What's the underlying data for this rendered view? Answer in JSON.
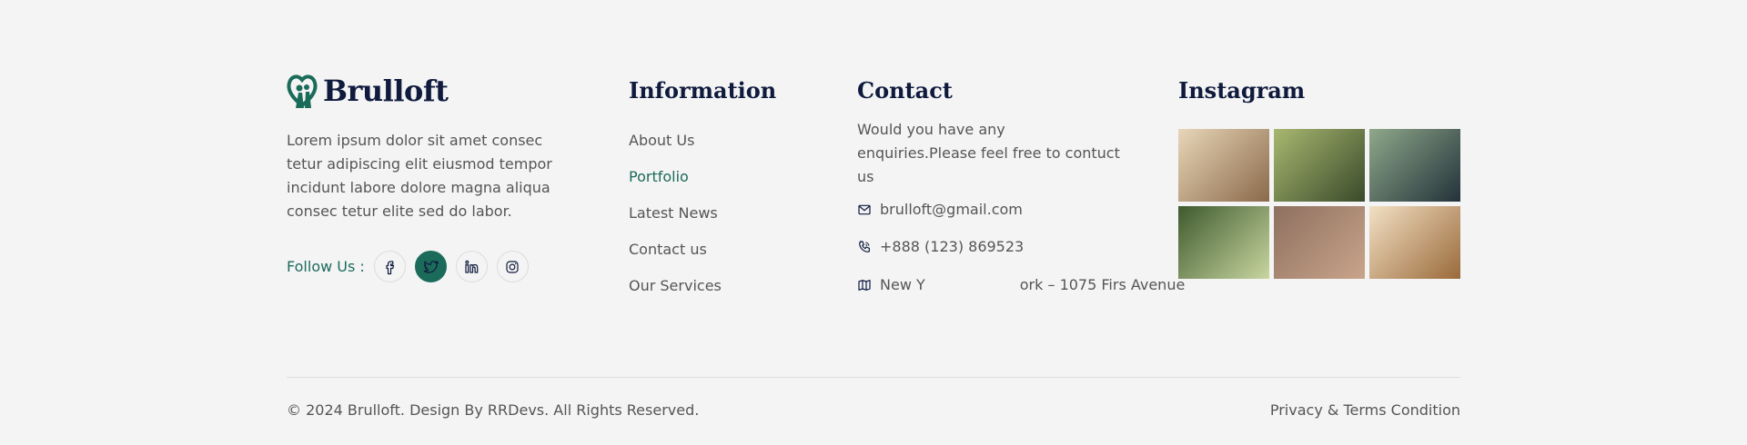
{
  "brand": {
    "name": "Brulloft",
    "logo_icon": "heart-couple-logo",
    "accent": "#1b6b5a"
  },
  "about": {
    "text": "Lorem ipsum dolor sit amet consec tetur adipiscing elit eiusmod tempor incidunt labore dolore magna aliqua consec tetur elite sed do labor."
  },
  "follow": {
    "label": "Follow Us :",
    "socials": [
      {
        "icon": "facebook-icon",
        "active": false
      },
      {
        "icon": "twitter-icon",
        "active": true
      },
      {
        "icon": "linkedin-icon",
        "active": false
      },
      {
        "icon": "instagram-icon",
        "active": false
      }
    ]
  },
  "information": {
    "title": "Information",
    "links": [
      "About Us",
      "Portfolio",
      "Latest News",
      "Contact us",
      "Our Services"
    ],
    "active_link": "Portfolio"
  },
  "contact": {
    "title": "Contact",
    "text": "Would you have any enquiries.Please feel free to contuct us",
    "email": "brulloft@gmail.com",
    "phone": "+888 (123) 869523",
    "address_part1": "New Y",
    "address_part2": "ork – 1075 Firs Avenue",
    "icons": [
      "mail-icon",
      "phone-icon",
      "map-icon"
    ]
  },
  "instagram": {
    "title": "Instagram",
    "photos": [
      {
        "name": "wedding-photo-1",
        "palette": [
          "#e8d6b8",
          "#8a6a4a"
        ]
      },
      {
        "name": "wedding-photo-2",
        "palette": [
          "#a8b870",
          "#3a4a2a"
        ]
      },
      {
        "name": "wedding-photo-3",
        "palette": [
          "#8fa88a",
          "#23323a"
        ]
      },
      {
        "name": "wedding-photo-4",
        "palette": [
          "#3f5a2e",
          "#c8d6a0"
        ]
      },
      {
        "name": "wedding-photo-5",
        "palette": [
          "#8e7060",
          "#c9a48a"
        ]
      },
      {
        "name": "wedding-photo-6",
        "palette": [
          "#f2e0c4",
          "#9a6a3a"
        ]
      }
    ]
  },
  "footer": {
    "copyright": "© 2024 Brulloft. Design By RRDevs. All Rights Reserved.",
    "terms": "Privacy & Terms Condition"
  }
}
